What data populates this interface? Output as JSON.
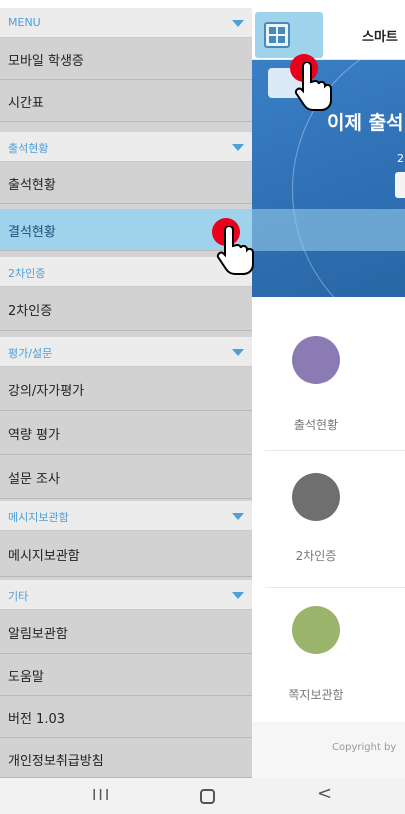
{
  "app": {
    "title": "스마트",
    "banner_text": "이제 출석",
    "banner_sub": "2",
    "tiles": [
      {
        "label": "출석현황",
        "icon": "attendance-icon",
        "color": "#8a7bb4"
      },
      {
        "label": "2차인증",
        "icon": "security-shield-icon",
        "color": "#6f6f6f"
      },
      {
        "label": "쪽지보관함",
        "icon": "message-box-icon",
        "color": "#9ab46b"
      }
    ],
    "copyright": "Copyright by"
  },
  "drawer": {
    "sections": [
      {
        "label": "MENU",
        "items": [
          "모바일 학생증",
          "시간표"
        ]
      },
      {
        "label": "출석현황",
        "items": [
          "출석현황",
          "결석현황"
        ]
      },
      {
        "label": "2차인증",
        "items": [
          "2차인증"
        ]
      },
      {
        "label": "평가/설문",
        "items": [
          "강의/자가평가",
          "역량 평가",
          "설문 조사"
        ]
      },
      {
        "label": "메시지보관함",
        "items": [
          "메시지보관함"
        ]
      },
      {
        "label": "기타",
        "items": [
          "알림보관함",
          "도움말",
          "버전 1.03",
          "개인정보취급방침"
        ]
      }
    ],
    "selected_item": "결석현황",
    "accent_color": "#4e9fd8",
    "highlight_color": "#9fd3ec"
  },
  "navbar": {
    "recent": "III",
    "back": "<"
  }
}
